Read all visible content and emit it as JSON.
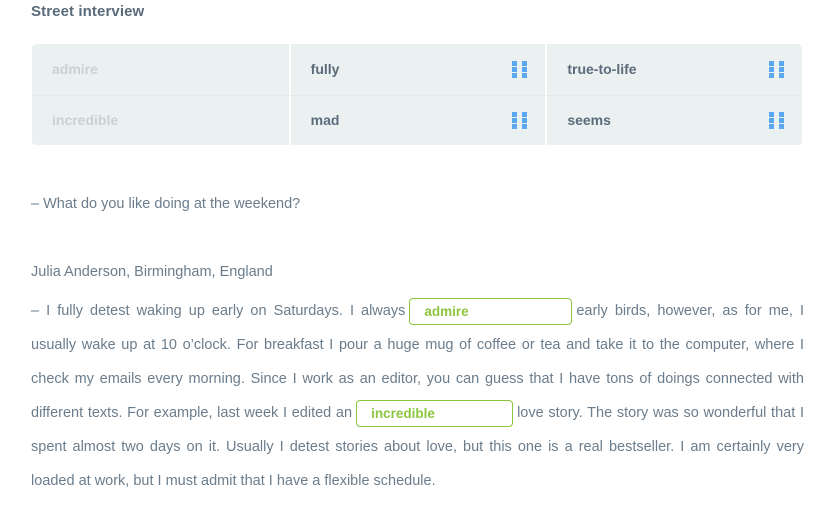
{
  "page": {
    "title": "Street interview"
  },
  "wordbank": {
    "handle_icon": "drag-handle-icon",
    "accent_color": "#5aa9f0",
    "background": "#ebf0f0",
    "items": [
      {
        "label": "admire",
        "used": true,
        "row": 1,
        "col": 1
      },
      {
        "label": "fully",
        "used": false,
        "row": 1,
        "col": 2
      },
      {
        "label": "true-to-life",
        "used": false,
        "row": 1,
        "col": 3
      },
      {
        "label": "incredible",
        "used": true,
        "row": 2,
        "col": 1
      },
      {
        "label": "mad",
        "used": false,
        "row": 2,
        "col": 2
      },
      {
        "label": "seems",
        "used": false,
        "row": 2,
        "col": 3
      }
    ]
  },
  "exercise": {
    "question": "– What do you like doing at the weekend?",
    "attribution": "Julia Anderson, Birmingham, England",
    "answer": {
      "segment_1": "– I fully detest waking up early on Saturdays. I always",
      "blank_1": "admire",
      "segment_2": "early birds, however, as for me, I usually wake up at 10 o’clock. For breakfast I pour a huge mug of coffee or tea and take it to the computer, where I check my emails every morning. Since I work as an editor, you can guess that I have tons of doings connected with different texts. For example, last week I edited an",
      "blank_2": "incredible",
      "segment_3": "love story. The story was so wonderful that I spent almost two days on it. Usually I detest stories about love, but this one is a real bestseller. I am certainly",
      "segment_4": "very loaded at work, but I must admit that I have a flexible schedule."
    },
    "answer_accent_color": "#8cc63e"
  }
}
